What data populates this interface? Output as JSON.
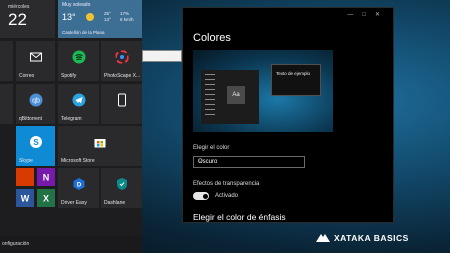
{
  "start_menu": {
    "weather": {
      "day": "miércoles",
      "date": "22",
      "condition": "Muy soleado",
      "temp": "13°",
      "high": "25°",
      "low": "13°",
      "humidity": "17%",
      "wind": "6 km/h",
      "location": "Castellón de la Plana"
    },
    "tiles": {
      "correo": "Correo",
      "spotify": "Spotify",
      "photoscape": "PhotoScape X...",
      "qbittorrent": "qBittorrent",
      "telegram": "Telegram",
      "skype": "Skype",
      "store": "Microsoft Store",
      "drivereasy": "Driver Easy",
      "dashlane": "Dashlane"
    },
    "bottom_text": "onfiguración"
  },
  "settings": {
    "title": "Colores",
    "preview_tile_text": "Aa",
    "sample_text": "Texto de ejemplo",
    "choose_color_label": "Elegir el color",
    "choose_color_value": "Oscuro",
    "transparency_label": "Efectos de transparencia",
    "transparency_value": "Activado",
    "accent_heading": "Elegir el color de énfasis"
  },
  "watermark": {
    "text": "XATAKA BASICS"
  },
  "colors": {
    "skype": "#0f8bd5",
    "spotify": "#1db954",
    "telegram": "#2aa3de"
  }
}
